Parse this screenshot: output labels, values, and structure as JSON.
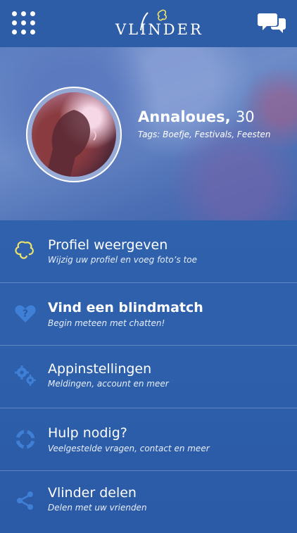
{
  "header": {
    "logo_text": "VLINDER",
    "menu_icon": "grid-icon",
    "chat_icon": "chat-bubbles-icon"
  },
  "profile": {
    "name": "Annaloues,",
    "age": "30",
    "tags": "Tags: Boefje, Festivals, Feesten"
  },
  "menu": {
    "items": [
      {
        "title": "Profiel weergeven",
        "subtitle": "Wijzig uw profiel en voeg foto’s toe",
        "icon": "butterfly-icon"
      },
      {
        "title": "Vind een blindmatch",
        "subtitle": "Begin meteen met chatten!",
        "icon": "heart-question-icon"
      },
      {
        "title": "Appinstellingen",
        "subtitle": "Meldingen, account en meer",
        "icon": "gears-icon"
      },
      {
        "title": "Hulp nodig?",
        "subtitle": "Veelgestelde vragen, contact en meer",
        "icon": "lifebuoy-icon"
      },
      {
        "title": "Vlinder delen",
        "subtitle": "Delen met uw vrienden",
        "icon": "share-icon"
      }
    ]
  },
  "colors": {
    "accent_blue": "#2e5da8",
    "butterfly_yellow": "#f0e56a",
    "icon_blue": "#3f7fd6"
  }
}
